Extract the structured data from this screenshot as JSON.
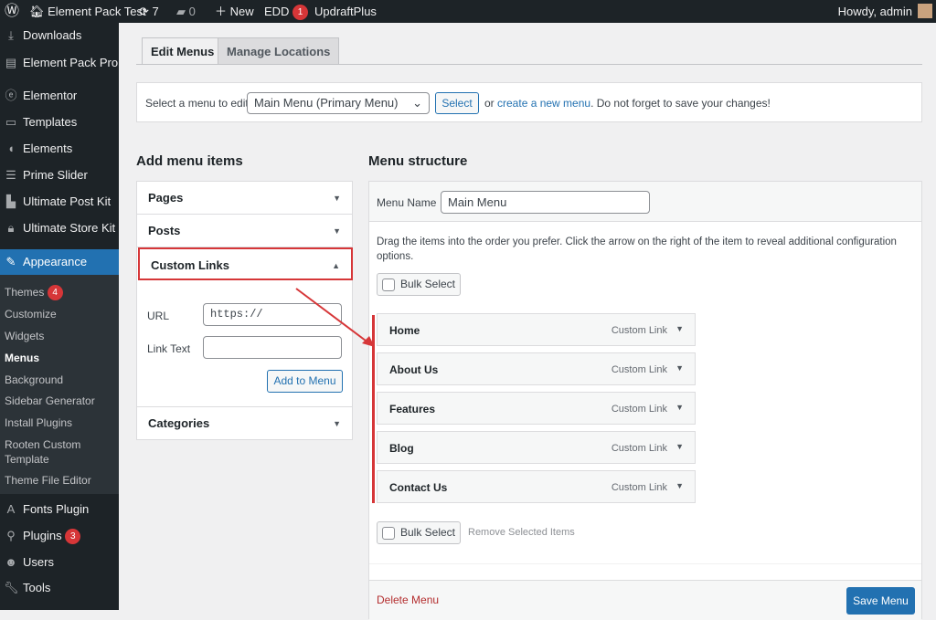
{
  "adminbar": {
    "site": "Element Pack Test",
    "updates": "7",
    "comments": "0",
    "new": "New",
    "edd": "EDD",
    "edd_count": "1",
    "updraft": "UpdraftPlus",
    "howdy": "Howdy, admin"
  },
  "sidebar": {
    "items": [
      {
        "label": "Downloads",
        "icon": "download-icon"
      },
      {
        "label": "Element Pack Pro",
        "icon": "element-pack-icon"
      },
      {
        "label": "Elementor",
        "icon": "elementor-icon"
      },
      {
        "label": "Templates",
        "icon": "folder-icon"
      },
      {
        "label": "Elements",
        "icon": "elements-icon"
      },
      {
        "label": "Prime Slider",
        "icon": "slider-icon"
      },
      {
        "label": "Ultimate Post Kit",
        "icon": "post-kit-icon"
      },
      {
        "label": "Ultimate Store Kit",
        "icon": "store-icon"
      },
      {
        "label": "Appearance",
        "icon": "brush-icon"
      }
    ],
    "submenu": [
      "Themes",
      "Customize",
      "Widgets",
      "Menus",
      "Background",
      "Sidebar Generator",
      "Install Plugins",
      "Rooten Custom Template",
      "Theme File Editor"
    ],
    "themes_count": "4",
    "bottom": [
      {
        "label": "Fonts Plugin",
        "icon": "font-icon"
      },
      {
        "label": "Plugins",
        "icon": "plugin-icon"
      },
      {
        "label": "Users",
        "icon": "users-icon"
      },
      {
        "label": "Tools",
        "icon": "tools-icon"
      }
    ],
    "plugins_count": "3"
  },
  "tabs": [
    "Edit Menus",
    "Manage Locations"
  ],
  "selectbar": {
    "label": "Select a menu to edit:",
    "value": "Main Menu (Primary Menu)",
    "button": "Select",
    "or": "or",
    "link": "create a new menu",
    "suffix": ". Do not forget to save your changes!"
  },
  "add": {
    "heading": "Add menu items",
    "sections": [
      "Pages",
      "Posts",
      "Custom Links",
      "Categories"
    ],
    "url_label": "URL",
    "url_value": "https://",
    "linktext_label": "Link Text",
    "add_button": "Add to Menu"
  },
  "structure": {
    "heading": "Menu structure",
    "name_label": "Menu Name",
    "name_value": "Main Menu",
    "instructions": "Drag the items into the order you prefer. Click the arrow on the right of the item to reveal additional configuration options.",
    "bulk": "Bulk Select",
    "remove": "Remove Selected Items",
    "delete": "Delete Menu",
    "save": "Save Menu",
    "items": [
      {
        "title": "Home",
        "type": "Custom Link"
      },
      {
        "title": "About Us",
        "type": "Custom Link"
      },
      {
        "title": "Features",
        "type": "Custom Link"
      },
      {
        "title": "Blog",
        "type": "Custom Link"
      },
      {
        "title": "Contact Us",
        "type": "Custom Link"
      }
    ]
  },
  "colors": {
    "accent": "#2271b1",
    "highlight": "#d63638"
  }
}
